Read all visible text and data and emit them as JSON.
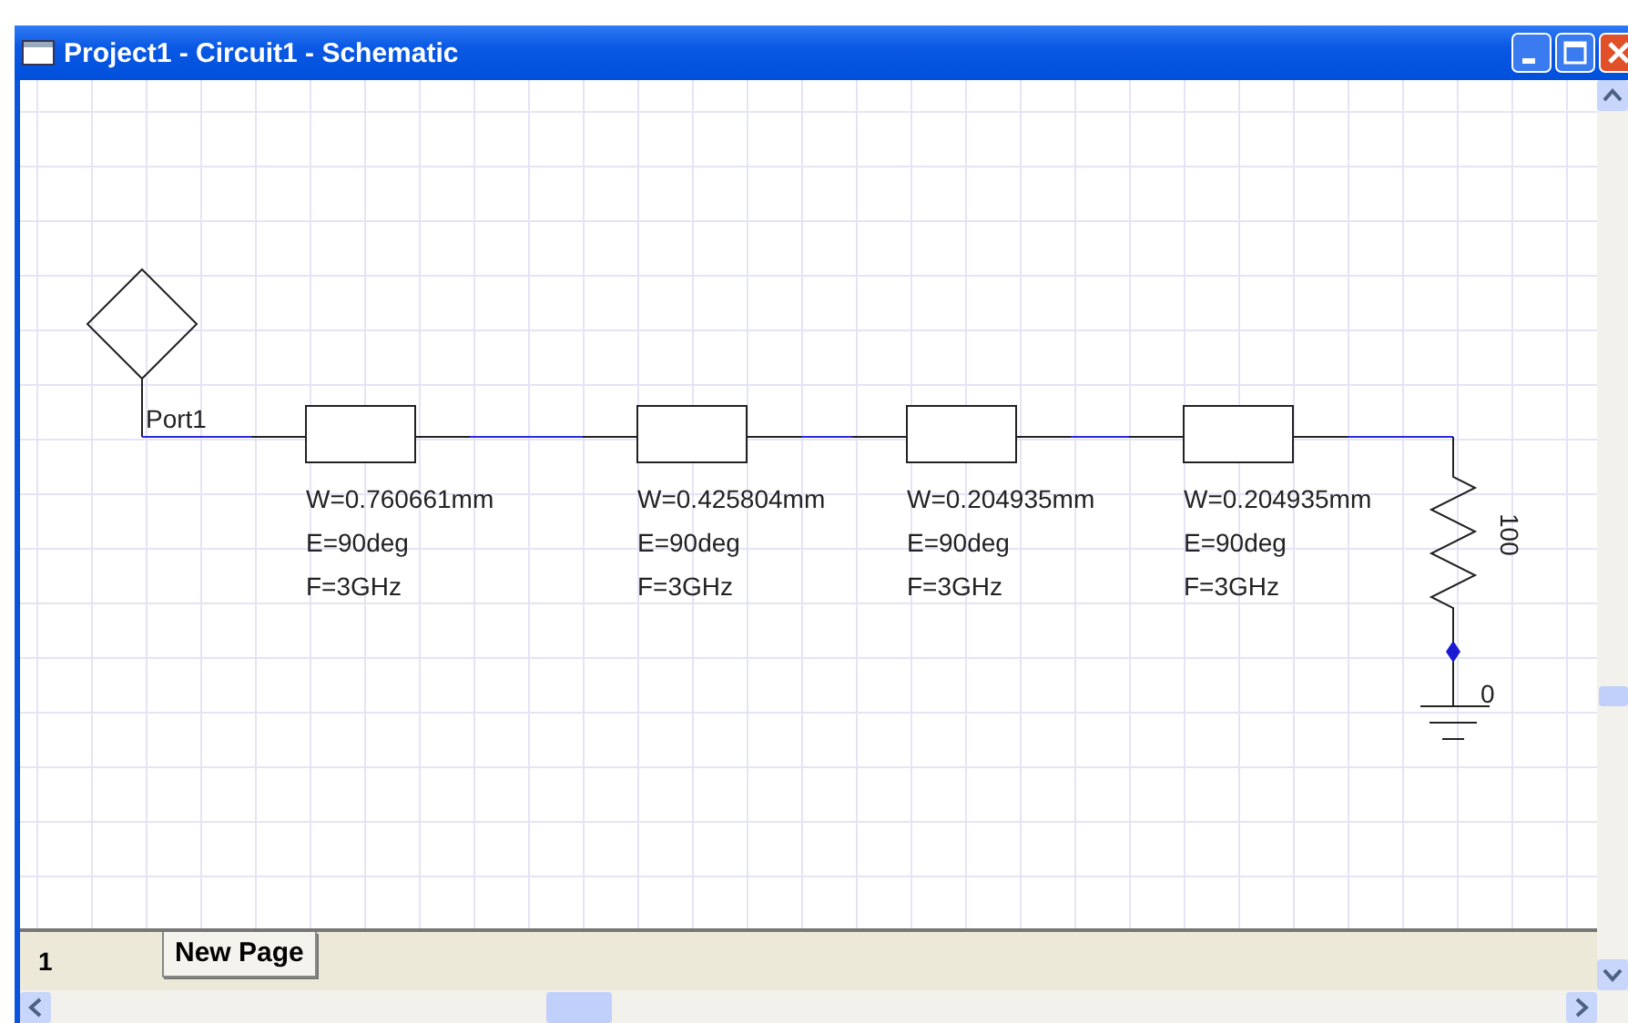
{
  "window": {
    "title": "Project1 - Circuit1 - Schematic"
  },
  "schematic": {
    "port": {
      "label": "Port1"
    },
    "lines": [
      {
        "w": "W=0.760661mm",
        "e": "E=90deg",
        "f": "F=3GHz"
      },
      {
        "w": "W=0.425804mm",
        "e": "E=90deg",
        "f": "F=3GHz"
      },
      {
        "w": "W=0.204935mm",
        "e": "E=90deg",
        "f": "F=3GHz"
      },
      {
        "w": "W=0.204935mm",
        "e": "E=90deg",
        "f": "F=3GHz"
      }
    ],
    "resistor": {
      "value": "100"
    },
    "ground": {
      "label": "0"
    }
  },
  "page_number": "1",
  "tabs": [
    {
      "label": "New Page",
      "selected": true
    }
  ]
}
